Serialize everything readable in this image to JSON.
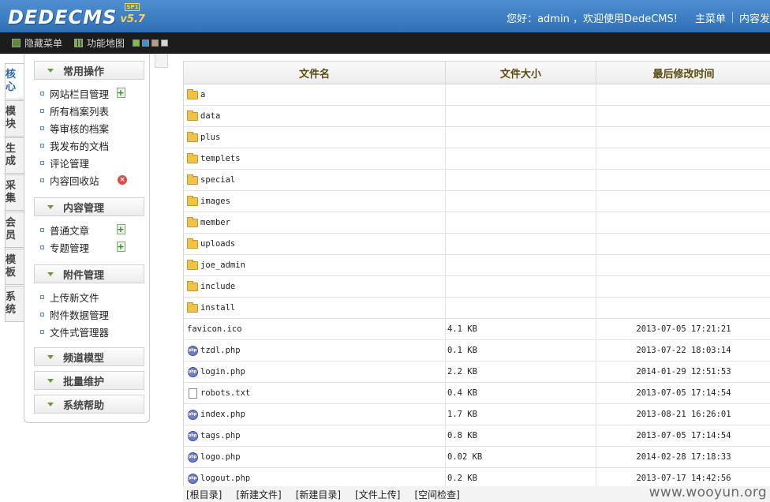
{
  "header": {
    "logo_text": "DEDECMS",
    "logo_version": "v5.7",
    "logo_sp": "SP1",
    "greeting": "您好：admin ，欢迎使用DedeCMS!",
    "main_menu": "主菜单",
    "content_publish": "内容发"
  },
  "toolbar": {
    "hide_menu": "隐藏菜单",
    "site_map": "功能地图",
    "swatch_colors": [
      "#7bc043",
      "#3f8fd8",
      "#b6a07a",
      "#d6d6d6"
    ]
  },
  "side_tabs": [
    {
      "label": "核心",
      "active": true
    },
    {
      "label": "模块"
    },
    {
      "label": "生成"
    },
    {
      "label": "采集"
    },
    {
      "label": "会员"
    },
    {
      "label": "模板"
    },
    {
      "label": "系统"
    }
  ],
  "menu": {
    "common_ops": "常用操作",
    "common_items": [
      "网站栏目管理",
      "所有档案列表",
      "等审核的档案",
      "我发布的文档",
      "评论管理",
      "内容回收站"
    ],
    "content_mgmt": "内容管理",
    "content_items": [
      "普通文章",
      "专题管理"
    ],
    "attach_mgmt": "附件管理",
    "attach_items": [
      "上传新文件",
      "附件数据管理",
      "文件式管理器"
    ],
    "channel_model": "频道模型",
    "batch_maint": "批量维护",
    "sys_help": "系统帮助"
  },
  "table": {
    "headers": [
      "文件名",
      "文件大小",
      "最后修改时间"
    ],
    "rows": [
      {
        "icon": "folder",
        "name": "a",
        "size": "",
        "time": ""
      },
      {
        "icon": "folder",
        "name": "data",
        "size": "",
        "time": ""
      },
      {
        "icon": "folder",
        "name": "plus",
        "size": "",
        "time": ""
      },
      {
        "icon": "folder",
        "name": "templets",
        "size": "",
        "time": ""
      },
      {
        "icon": "folder",
        "name": "special",
        "size": "",
        "time": ""
      },
      {
        "icon": "folder",
        "name": "images",
        "size": "",
        "time": ""
      },
      {
        "icon": "folder",
        "name": "member",
        "size": "",
        "time": ""
      },
      {
        "icon": "folder",
        "name": "uploads",
        "size": "",
        "time": ""
      },
      {
        "icon": "folder",
        "name": "joe_admin",
        "size": "",
        "time": ""
      },
      {
        "icon": "folder",
        "name": "include",
        "size": "",
        "time": ""
      },
      {
        "icon": "folder",
        "name": "install",
        "size": "",
        "time": ""
      },
      {
        "icon": "none",
        "name": "favicon.ico",
        "size": "4.1 KB",
        "time": "2013-07-05 17:21:21"
      },
      {
        "icon": "php",
        "name": "tzdl.php",
        "size": "0.1 KB",
        "time": "2013-07-22 18:03:14"
      },
      {
        "icon": "php",
        "name": "login.php",
        "size": "2.2 KB",
        "time": "2014-01-29 12:51:53"
      },
      {
        "icon": "txt",
        "name": "robots.txt",
        "size": "0.4 KB",
        "time": "2013-07-05 17:14:54"
      },
      {
        "icon": "php",
        "name": "index.php",
        "size": "1.7 KB",
        "time": "2013-08-21 16:26:01"
      },
      {
        "icon": "php",
        "name": "tags.php",
        "size": "0.8 KB",
        "time": "2013-07-05 17:14:54"
      },
      {
        "icon": "php",
        "name": "logo.php",
        "size": "0.02 KB",
        "time": "2014-02-28 17:18:33"
      },
      {
        "icon": "php",
        "name": "logout.php",
        "size": "0.2 KB",
        "time": "2013-07-17 14:42:56"
      }
    ]
  },
  "footer": {
    "links": [
      "[根目录]",
      "[新建文件]",
      "[新建目录]",
      "[文件上传]",
      "[空间检查]"
    ]
  },
  "watermark": "www.wooyun.org"
}
